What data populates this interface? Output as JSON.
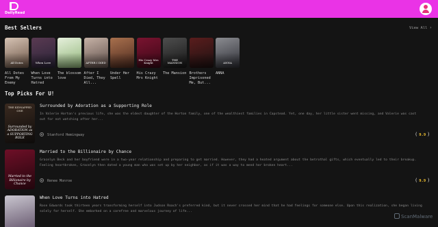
{
  "header": {
    "logo_text": "DailyRead",
    "brand_color": "#ea33e6"
  },
  "best_sellers": {
    "title": "Best Sellers",
    "view_all": "View All",
    "books": [
      {
        "title": "All Dotes From My Enemy",
        "cover_tag": "All Dotes",
        "c1": "#d6c3b4",
        "c2": "#6b5445"
      },
      {
        "title": "When Love Turns into Hatred",
        "cover_tag": "When Love",
        "c1": "#5a3a52",
        "c2": "#2a2438"
      },
      {
        "title": "The blossom love",
        "cover_tag": "",
        "c1": "#e6f0dc",
        "c2": "#8fb477"
      },
      {
        "title": "After I Died, They All...",
        "cover_tag": "AFTER I DIED",
        "c1": "#c6b2a6",
        "c2": "#5d4d49"
      },
      {
        "title": "Under Her Spell",
        "cover_tag": "",
        "c1": "#a8704d",
        "c2": "#4d2a1f"
      },
      {
        "title": "His Crazy Mrs Knight",
        "cover_tag": "His Crazy Mrs Knight",
        "c1": "#7a1330",
        "c2": "#3a0816"
      },
      {
        "title": "The Mansion",
        "cover_tag": "THE MANSION",
        "c1": "#4e4e4e",
        "c2": "#161616"
      },
      {
        "title": "Brothers Imprisoned Me, But...",
        "cover_tag": "",
        "c1": "#5a1d1d",
        "c2": "#1e1212"
      },
      {
        "title": "ANNA",
        "cover_tag": "ANNA",
        "c1": "#8b8c91",
        "c2": "#2e2f36"
      }
    ]
  },
  "top_picks": {
    "title": "Top Picks For U!",
    "items": [
      {
        "title": "Surrounded by Adoration as a Supporting Role",
        "description": "In Valerie Horton's previous life, she was the eldest daughter of the Horton family, one of the wealthiest families in Capstead. Yet, one day, her little sister went missing, and Valerie was cast out for not watching after her...",
        "author": "Stanford Hemingway",
        "rating": "9.9",
        "cover_top": "THE KIDNAPPED ONE",
        "cover_tag": "Surrounded by ADORATION as a SUPPORTING ROLE",
        "c1": "#3a2a20",
        "c2": "#0d0b0a"
      },
      {
        "title": "Married to the Billionaire by Chance",
        "description": "Gracelyn Beck and her boyfriend were in a two-year relationship and preparing to get married. However, they had a heated argument about the betrothal gifts, which eventually led to their breakup. Feeling heartbroken, Gracelyn then dated a young man who was set up by her neighbor, as if it was a way to mend her broken heart...",
        "author": "Renee Monroe",
        "rating": "9.9",
        "cover_top": "",
        "cover_tag": "Married to the Billionaire by Chance",
        "c1": "#6e0f27",
        "c2": "#22060d"
      },
      {
        "title": "When Love Turns into Hatred",
        "description": "Rose Edwards took thirteen years transforming herself into Judson Roach's preferred kind, but it never crossed her mind that he had feelings for someone else. Upon this realization, she began living solely for herself. She embarked on a carefree and marvelous journey of life...",
        "author": "",
        "rating": "",
        "cover_top": "",
        "cover_tag": "",
        "c1": "#c9c6cf",
        "c2": "#5b4a63"
      }
    ]
  },
  "watermark": "ScanMalware"
}
